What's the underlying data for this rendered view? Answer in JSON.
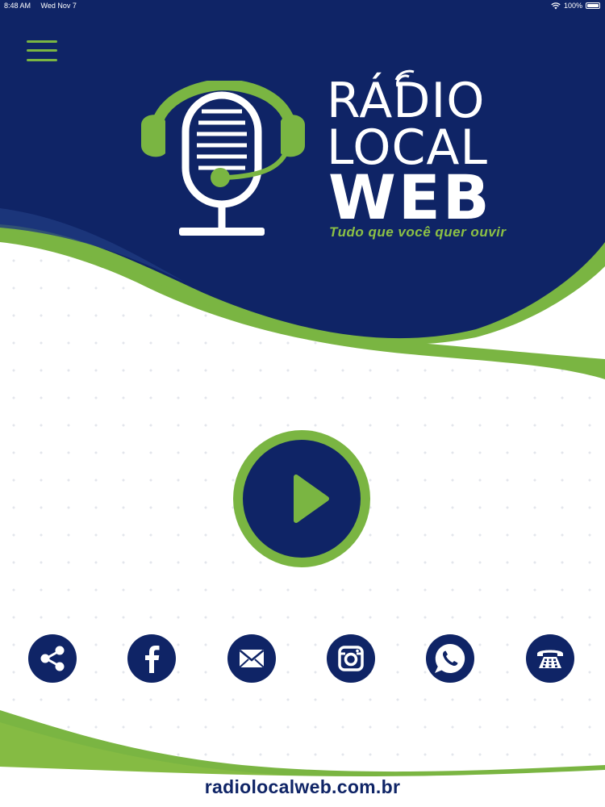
{
  "status_bar": {
    "time": "8:48 AM",
    "date": "Wed Nov 7",
    "battery": "100%"
  },
  "menu": {
    "icon": "hamburger-menu-icon"
  },
  "logo": {
    "line1": "RÁDIO",
    "line2": "LOCAL",
    "line3": "WEB",
    "tagline": "Tudo que você quer ouvir",
    "icon": "microphone-headset-icon"
  },
  "player": {
    "icon": "play-icon"
  },
  "social": [
    {
      "name": "share",
      "icon": "share-icon"
    },
    {
      "name": "facebook",
      "icon": "facebook-icon"
    },
    {
      "name": "email",
      "icon": "mail-icon"
    },
    {
      "name": "instagram",
      "icon": "instagram-icon"
    },
    {
      "name": "whatsapp",
      "icon": "whatsapp-icon"
    },
    {
      "name": "telephone",
      "icon": "telephone-icon"
    }
  ],
  "footer": {
    "website": "radiolocalweb.com.br"
  },
  "colors": {
    "navy": "#0f2466",
    "green": "#7ab542",
    "white": "#ffffff"
  }
}
